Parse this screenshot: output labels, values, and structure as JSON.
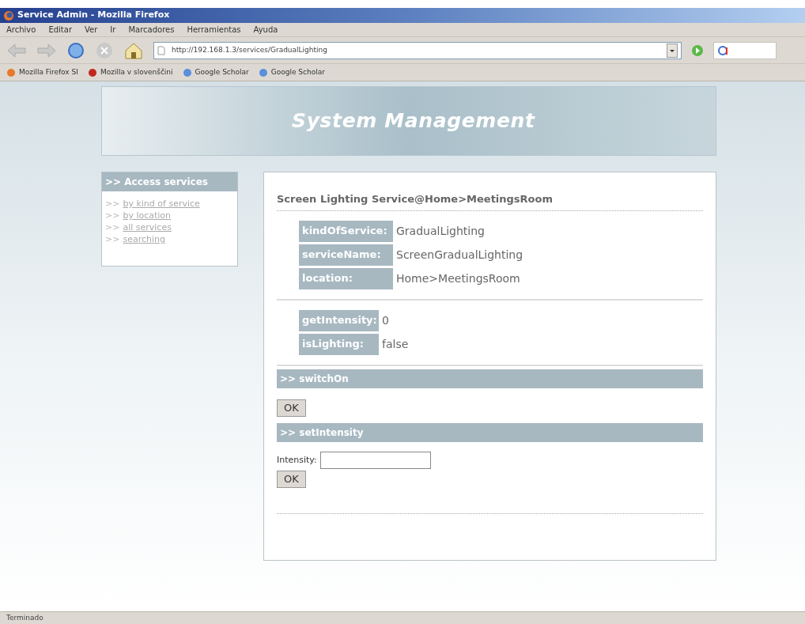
{
  "window": {
    "title": "Service Admin - Mozilla Firefox"
  },
  "menu": [
    "Archivo",
    "Editar",
    "Ver",
    "Ir",
    "Marcadores",
    "Herramientas",
    "Ayuda"
  ],
  "address": {
    "value": "http://192.168.1.3/services/GradualLighting"
  },
  "bookmarks": [
    "Mozilla Firefox SI",
    "Mozilla v slovenščini",
    "Google Scholar",
    "Google Scholar"
  ],
  "banner": {
    "title": "System Management"
  },
  "sidebar": {
    "title": ">> Access services",
    "items": [
      {
        "marker": ">>",
        "label": "by kind of service"
      },
      {
        "marker": ">>",
        "label": "by location"
      },
      {
        "marker": ">>",
        "label": "all services"
      },
      {
        "marker": ">>",
        "label": "searching"
      }
    ]
  },
  "service": {
    "heading": "Screen Lighting Service@Home>MeetingsRoom",
    "properties": [
      {
        "name": "kindOfService:",
        "value": "GradualLighting"
      },
      {
        "name": "serviceName:",
        "value": "ScreenGradualLighting"
      },
      {
        "name": "location:",
        "value": "Home>MeetingsRoom"
      }
    ],
    "readings": [
      {
        "name": "getIntensity:",
        "value": "0"
      },
      {
        "name": "isLighting:",
        "value": "false"
      }
    ],
    "operations": [
      {
        "title": ">> switchOn",
        "button": "OK"
      },
      {
        "title": ">> setIntensity",
        "fields": [
          {
            "label": "Intensity:"
          }
        ],
        "button": "OK"
      }
    ]
  },
  "status_bar": {
    "text": "Terminado"
  }
}
